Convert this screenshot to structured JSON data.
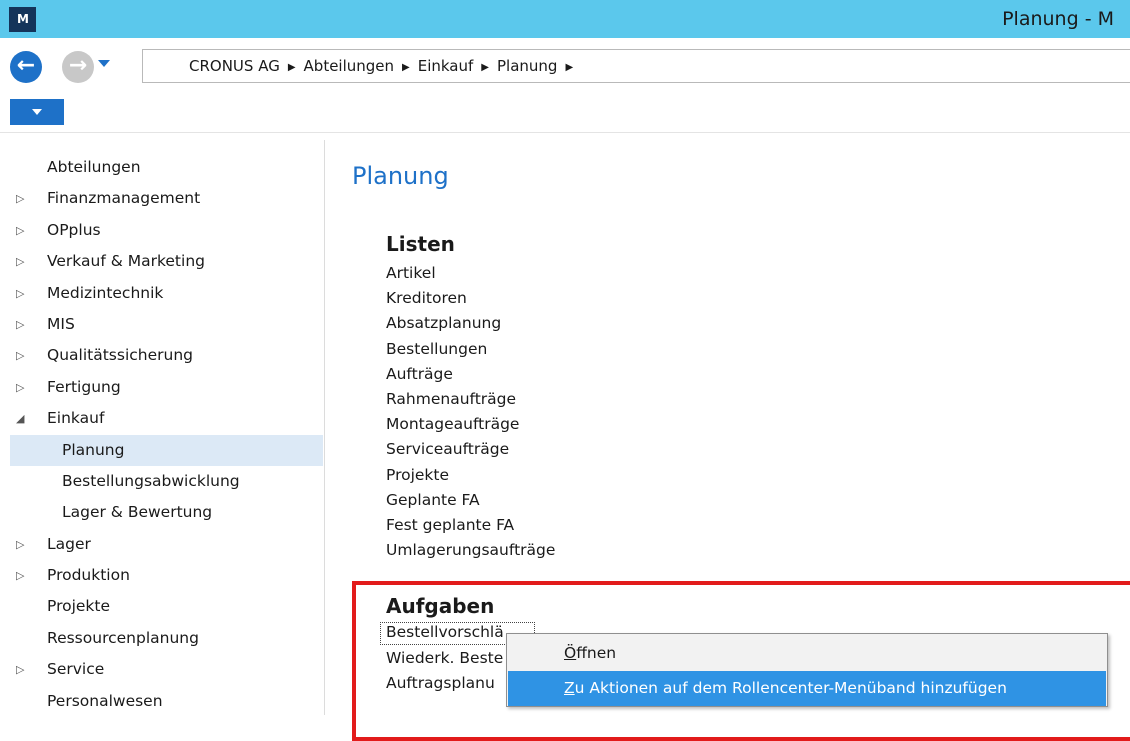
{
  "window": {
    "logo_text": "M",
    "title": "Planung - M"
  },
  "nav": {
    "breadcrumb": [
      "CRONUS AG",
      "Abteilungen",
      "Einkauf",
      "Planung"
    ],
    "separator": "▶"
  },
  "sidebar": {
    "root_label": "Abteilungen",
    "items": [
      {
        "label": "Finanzmanagement",
        "arrow": "▷"
      },
      {
        "label": "OPplus",
        "arrow": "▷"
      },
      {
        "label": "Verkauf & Marketing",
        "arrow": "▷"
      },
      {
        "label": "Medizintechnik",
        "arrow": "▷"
      },
      {
        "label": "MIS",
        "arrow": "▷"
      },
      {
        "label": "Qualitätssicherung",
        "arrow": "▷"
      },
      {
        "label": "Fertigung",
        "arrow": "▷"
      },
      {
        "label": "Einkauf",
        "arrow": "◢"
      },
      {
        "label": "Planung"
      },
      {
        "label": "Bestellungsabwicklung"
      },
      {
        "label": "Lager & Bewertung"
      },
      {
        "label": "Lager",
        "arrow": "▷"
      },
      {
        "label": "Produktion",
        "arrow": "▷"
      },
      {
        "label": "Projekte"
      },
      {
        "label": "Ressourcenplanung"
      },
      {
        "label": "Service",
        "arrow": "▷"
      },
      {
        "label": "Personalwesen"
      }
    ]
  },
  "main": {
    "title": "Planung",
    "lists_heading": "Listen",
    "lists": [
      "Artikel",
      "Kreditoren",
      "Absatzplanung",
      "Bestellungen",
      "Aufträge",
      "Rahmenaufträge",
      "Montageaufträge",
      "Serviceaufträge",
      "Projekte",
      "Geplante FA",
      "Fest geplante FA",
      "Umlagerungsaufträge"
    ],
    "tasks_heading": "Aufgaben",
    "tasks": [
      "Bestellvorschlä",
      "Wiederk. Beste",
      "Auftragsplanu"
    ]
  },
  "context_menu": {
    "open_underline": "Ö",
    "open_rest": "ffnen",
    "add_underline": "Z",
    "add_rest": "u Aktionen auf dem Rollencenter-Menüband hinzufügen"
  },
  "colors": {
    "titlebar": "#5bc8ec",
    "accent": "#1e71c8",
    "selected_row": "#dce9f6",
    "menu_hover": "#2f93e4",
    "highlight_frame": "#e21b1b"
  }
}
